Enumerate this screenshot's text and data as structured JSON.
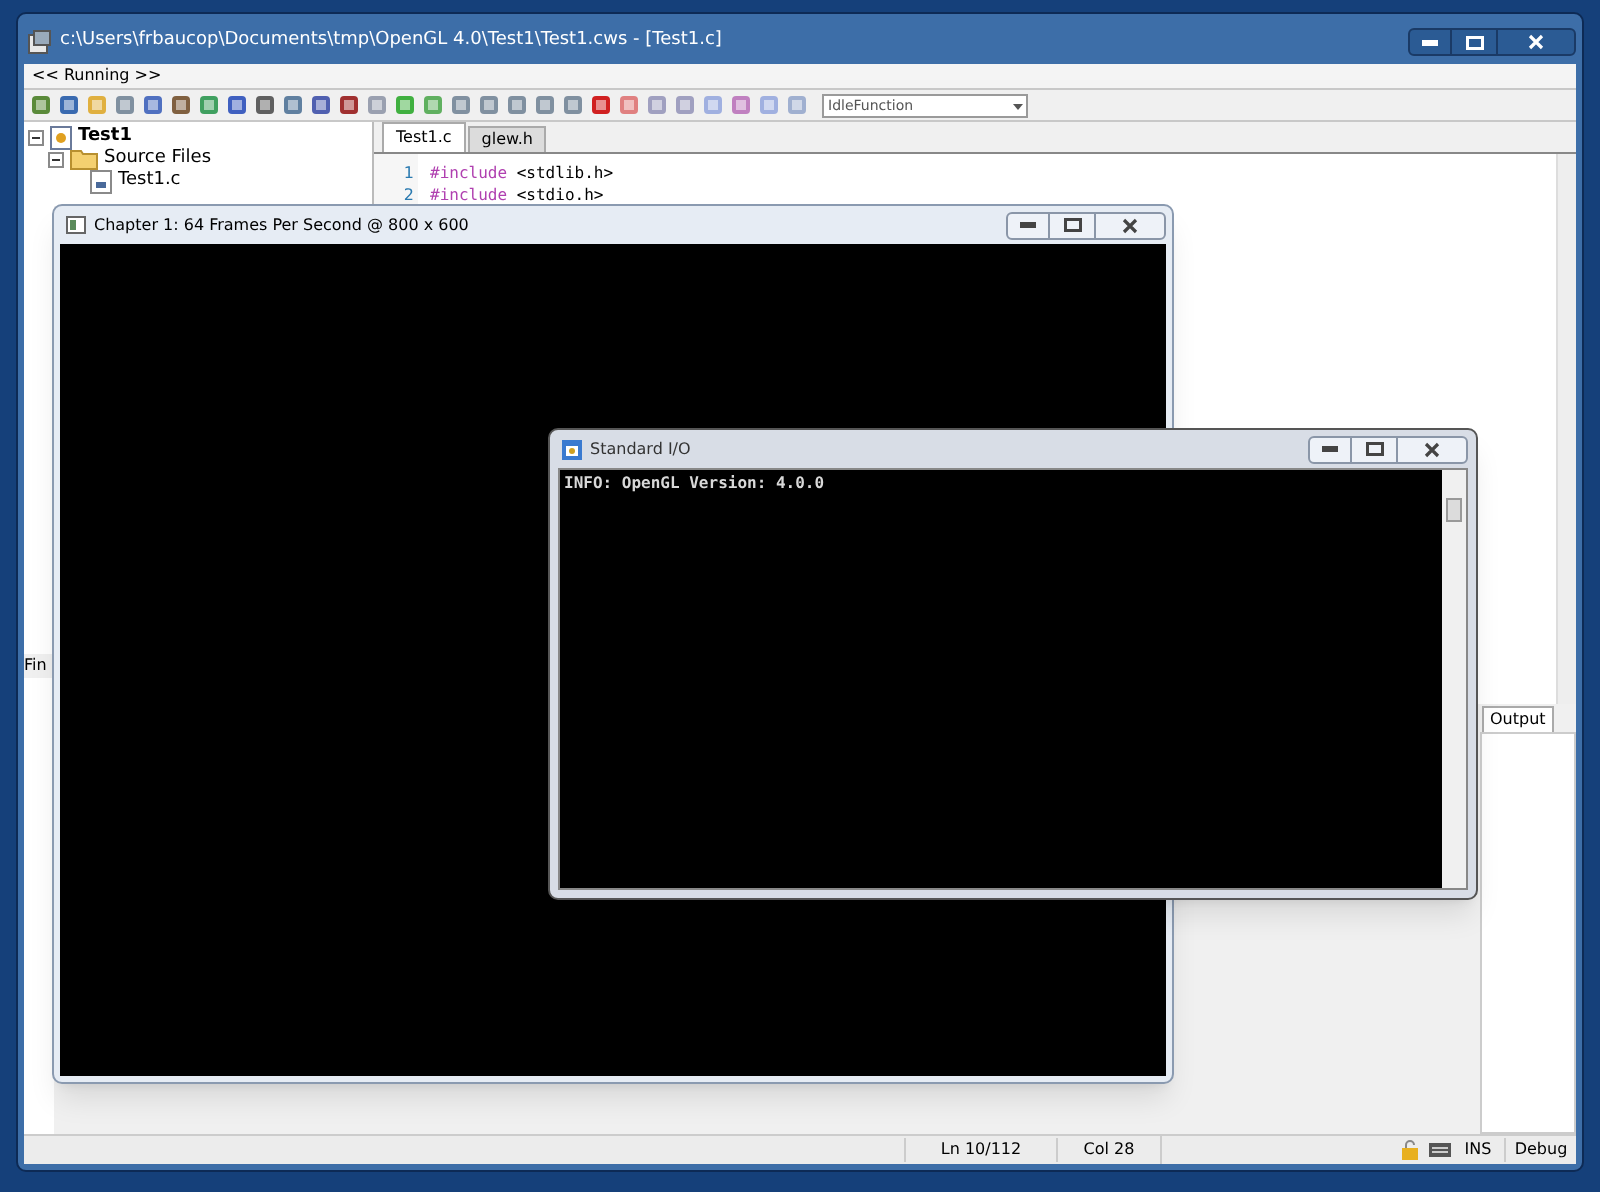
{
  "window": {
    "title": "c:\\Users\\frbaucop\\Documents\\tmp\\OpenGL 4.0\\Test1\\Test1.cws - [Test1.c]"
  },
  "menu": {
    "label": "<< Running >>"
  },
  "toolbar": {
    "combo": "IdleFunction"
  },
  "project_tree": [
    {
      "label": "Test1",
      "kind": "project",
      "expanded": true,
      "children": [
        {
          "label": "Source Files",
          "kind": "folder",
          "expanded": true,
          "children": [
            {
              "label": "Test1.c",
              "kind": "file"
            }
          ]
        }
      ]
    }
  ],
  "find_panel": {
    "title": "Fin"
  },
  "editor": {
    "tabs": [
      {
        "label": "Test1.c",
        "selected": true
      },
      {
        "label": "glew.h",
        "selected": false
      }
    ],
    "lines": [
      {
        "number": "1",
        "directive": "#include",
        "arg": "<stdlib.h>"
      },
      {
        "number": "2",
        "directive": "#include",
        "arg": "<stdio.h>"
      }
    ]
  },
  "output_panel": {
    "tab": "Output"
  },
  "status_bar": {
    "line": "Ln 10/112",
    "col": "Col 28",
    "mode": "INS",
    "config": "Debug"
  },
  "gl_window": {
    "title": "Chapter 1: 64 Frames Per Second @ 800 x 600"
  },
  "console": {
    "title": "Standard I/O",
    "lines": [
      "INFO: OpenGL Version: 4.0.0"
    ]
  }
}
